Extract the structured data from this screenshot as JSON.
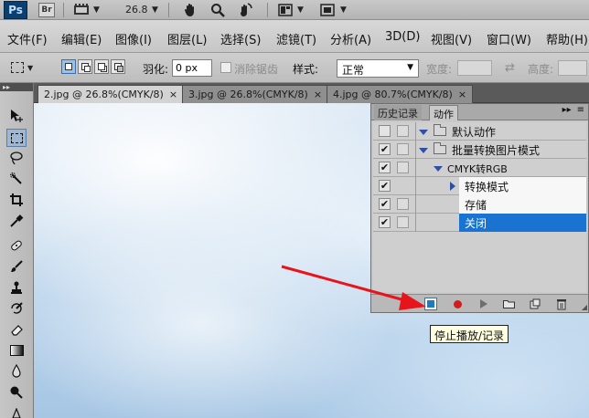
{
  "app": {
    "logo": "Ps",
    "bridge_logo": "Br",
    "zoom": "26.8",
    "icons": [
      "film-icon",
      "hand-icon",
      "zoom-icon",
      "rotate-view-icon",
      "arrange-icon",
      "screen-mode-icon"
    ]
  },
  "menu": [
    "文件(F)",
    "编辑(E)",
    "图像(I)",
    "图层(L)",
    "选择(S)",
    "滤镜(T)",
    "分析(A)",
    "3D(D)",
    "视图(V)",
    "窗口(W)",
    "帮助(H)"
  ],
  "options": {
    "feather_label": "羽化:",
    "feather_value": "0 px",
    "antialias_label": "消除锯齿",
    "style_label": "样式:",
    "style_value": "正常",
    "width_label": "宽度:",
    "height_label": "高度:"
  },
  "tabs": [
    {
      "label": "2.jpg @ 26.8%(CMYK/8)",
      "close": "×",
      "active": true
    },
    {
      "label": "3.jpg @ 26.8%(CMYK/8)",
      "close": "×",
      "active": false
    },
    {
      "label": "4.jpg @ 80.7%(CMYK/8)",
      "close": "×",
      "active": false
    }
  ],
  "actions_panel": {
    "tab_history": "历史记录",
    "tab_actions": "动作",
    "menu_arrows": "▸▸",
    "menu_lines": "≡",
    "rows": [
      {
        "label": "默认动作",
        "checked": false,
        "type": "set"
      },
      {
        "label": "批量转换图片模式",
        "checked": true,
        "type": "set"
      },
      {
        "label": "CMYK转RGB",
        "checked": true,
        "type": "action"
      },
      {
        "label": "转换模式",
        "checked": true,
        "type": "step"
      },
      {
        "label": "存储",
        "checked": true,
        "type": "step"
      },
      {
        "label": "关闭",
        "checked": true,
        "type": "step",
        "selected": true
      }
    ],
    "check_glyph": "✔"
  },
  "tooltip": "停止播放/记录",
  "colors": {
    "selection": "#1a73d1",
    "arrow": "#e8141c",
    "record": "#d11d1d",
    "stop": "#1e7bc0"
  }
}
